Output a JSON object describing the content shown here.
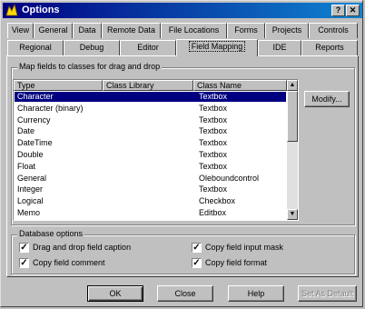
{
  "window": {
    "title": "Options",
    "close_glyph": "✕",
    "help_glyph": "?"
  },
  "tabs_row1": [
    "View",
    "General",
    "Data",
    "Remote Data",
    "File Locations",
    "Forms",
    "Projects",
    "Controls"
  ],
  "tabs_row2": [
    "Regional",
    "Debug",
    "Editor",
    "Field Mapping",
    "IDE",
    "Reports"
  ],
  "mapping": {
    "group_label": "Map fields to classes for drag and drop",
    "columns": [
      "Type",
      "Class Library",
      "Class Name"
    ],
    "rows": [
      {
        "type": "Character",
        "library": "",
        "class": "Textbox"
      },
      {
        "type": "Character (binary)",
        "library": "",
        "class": "Textbox"
      },
      {
        "type": "Currency",
        "library": "",
        "class": "Textbox"
      },
      {
        "type": "Date",
        "library": "",
        "class": "Textbox"
      },
      {
        "type": "DateTime",
        "library": "",
        "class": "Textbox"
      },
      {
        "type": "Double",
        "library": "",
        "class": "Textbox"
      },
      {
        "type": "Float",
        "library": "",
        "class": "Textbox"
      },
      {
        "type": "General",
        "library": "",
        "class": "Oleboundcontrol"
      },
      {
        "type": "Integer",
        "library": "",
        "class": "Textbox"
      },
      {
        "type": "Logical",
        "library": "",
        "class": "Checkbox"
      },
      {
        "type": "Memo",
        "library": "",
        "class": "Editbox"
      }
    ],
    "modify_label": "Modify..."
  },
  "database": {
    "group_label": "Database options",
    "options": [
      {
        "label": "Drag and drop field caption",
        "checked": true
      },
      {
        "label": "Copy field input mask",
        "checked": true
      },
      {
        "label": "Copy field comment",
        "checked": true
      },
      {
        "label": "Copy field format",
        "checked": true
      }
    ]
  },
  "buttons": {
    "ok": "OK",
    "close": "Close",
    "help": "Help",
    "set_default": "Set As Default"
  },
  "colors": {
    "selection": "#000080",
    "title_start": "#000080",
    "title_end": "#1084d0"
  }
}
